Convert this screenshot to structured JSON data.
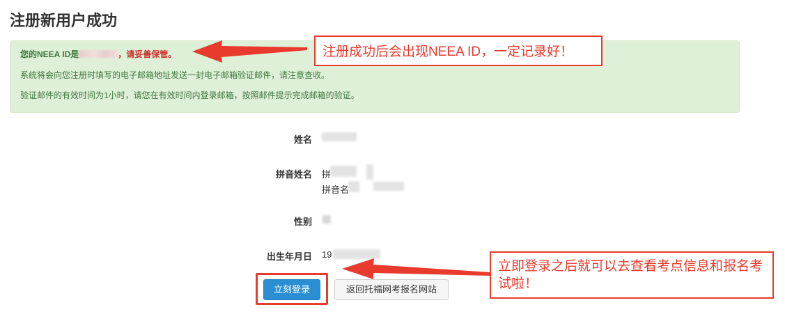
{
  "page_title": "注册新用户成功",
  "alert": {
    "id_prefix": "您的NEEA ID是",
    "keep_safe": "，请妥善保管。",
    "line2": "系统将会向您注册时填写的电子邮箱地址发送一封电子邮箱验证邮件，请注意查收。",
    "line3": "验证邮件的有效时间为1小时，请您在有效时间内登录邮箱，按照邮件提示完成邮箱的验证。"
  },
  "fields": {
    "name_label": "姓名",
    "pinyin_label": "拼音姓名",
    "pinyin_line1_partial": "拼",
    "pinyin_line2_partial": "拼音名",
    "gender_label": "性别",
    "dob_label": "出生年月日",
    "dob_partial": "19"
  },
  "buttons": {
    "login": "立刻登录",
    "back": "返回托福网考报名网站"
  },
  "annotations": {
    "callout1": "注册成功后会出现NEEA ID，一定记录好！",
    "callout2": "立即登录之后就可以去查看考点信息和报名考试啦！"
  },
  "colors": {
    "alert_bg": "#dff0d8",
    "alert_text": "#3c763d",
    "primary_button": "#2a8fd2",
    "annotation_red": "#e83a2d"
  }
}
